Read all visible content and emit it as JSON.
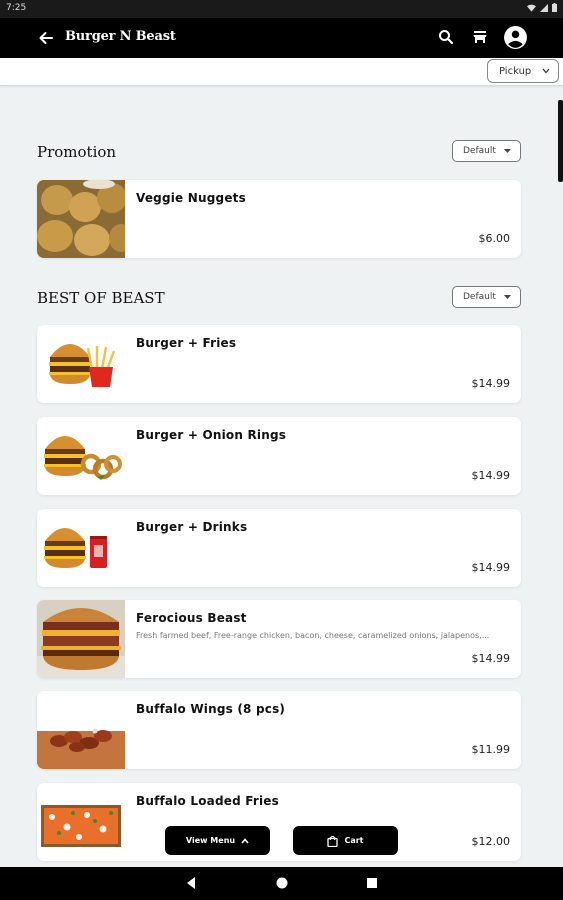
{
  "status_bar": {
    "time": "7:25"
  },
  "app_bar": {
    "title": "Burger N Beast",
    "icons": [
      "back-arrow-icon",
      "search-icon",
      "store-icon",
      "account-circle-icon"
    ]
  },
  "filter": {
    "pickup_label": "Pickup"
  },
  "sections": [
    {
      "title": "Promotion",
      "sort_label": "Default",
      "items": [
        {
          "name": "Veggie Nuggets",
          "description": "",
          "price": "$6.00"
        }
      ]
    },
    {
      "title": "BEST OF BEAST",
      "sort_label": "Default",
      "items": [
        {
          "name": "Burger + Fries",
          "description": "",
          "price": "$14.99"
        },
        {
          "name": "Burger + Onion Rings",
          "description": "",
          "price": "$14.99"
        },
        {
          "name": "Burger + Drinks",
          "description": "",
          "price": "$14.99"
        },
        {
          "name": "Ferocious Beast",
          "description": "Fresh farmed beef, Free-range chicken, bacon, cheese, caramelized onions, jalapenos,...",
          "price": "$14.99"
        },
        {
          "name": "Buffalo Wings (8 pcs)",
          "description": "",
          "price": "$11.99"
        },
        {
          "name": "Buffalo Loaded Fries",
          "description": "",
          "price": "$12.00"
        }
      ]
    }
  ],
  "bottom_actions": {
    "view_menu_label": "View Menu",
    "cart_label": "Cart"
  },
  "colors": {
    "bar": "#000000",
    "background": "#eef2f3",
    "card": "#ffffff"
  }
}
